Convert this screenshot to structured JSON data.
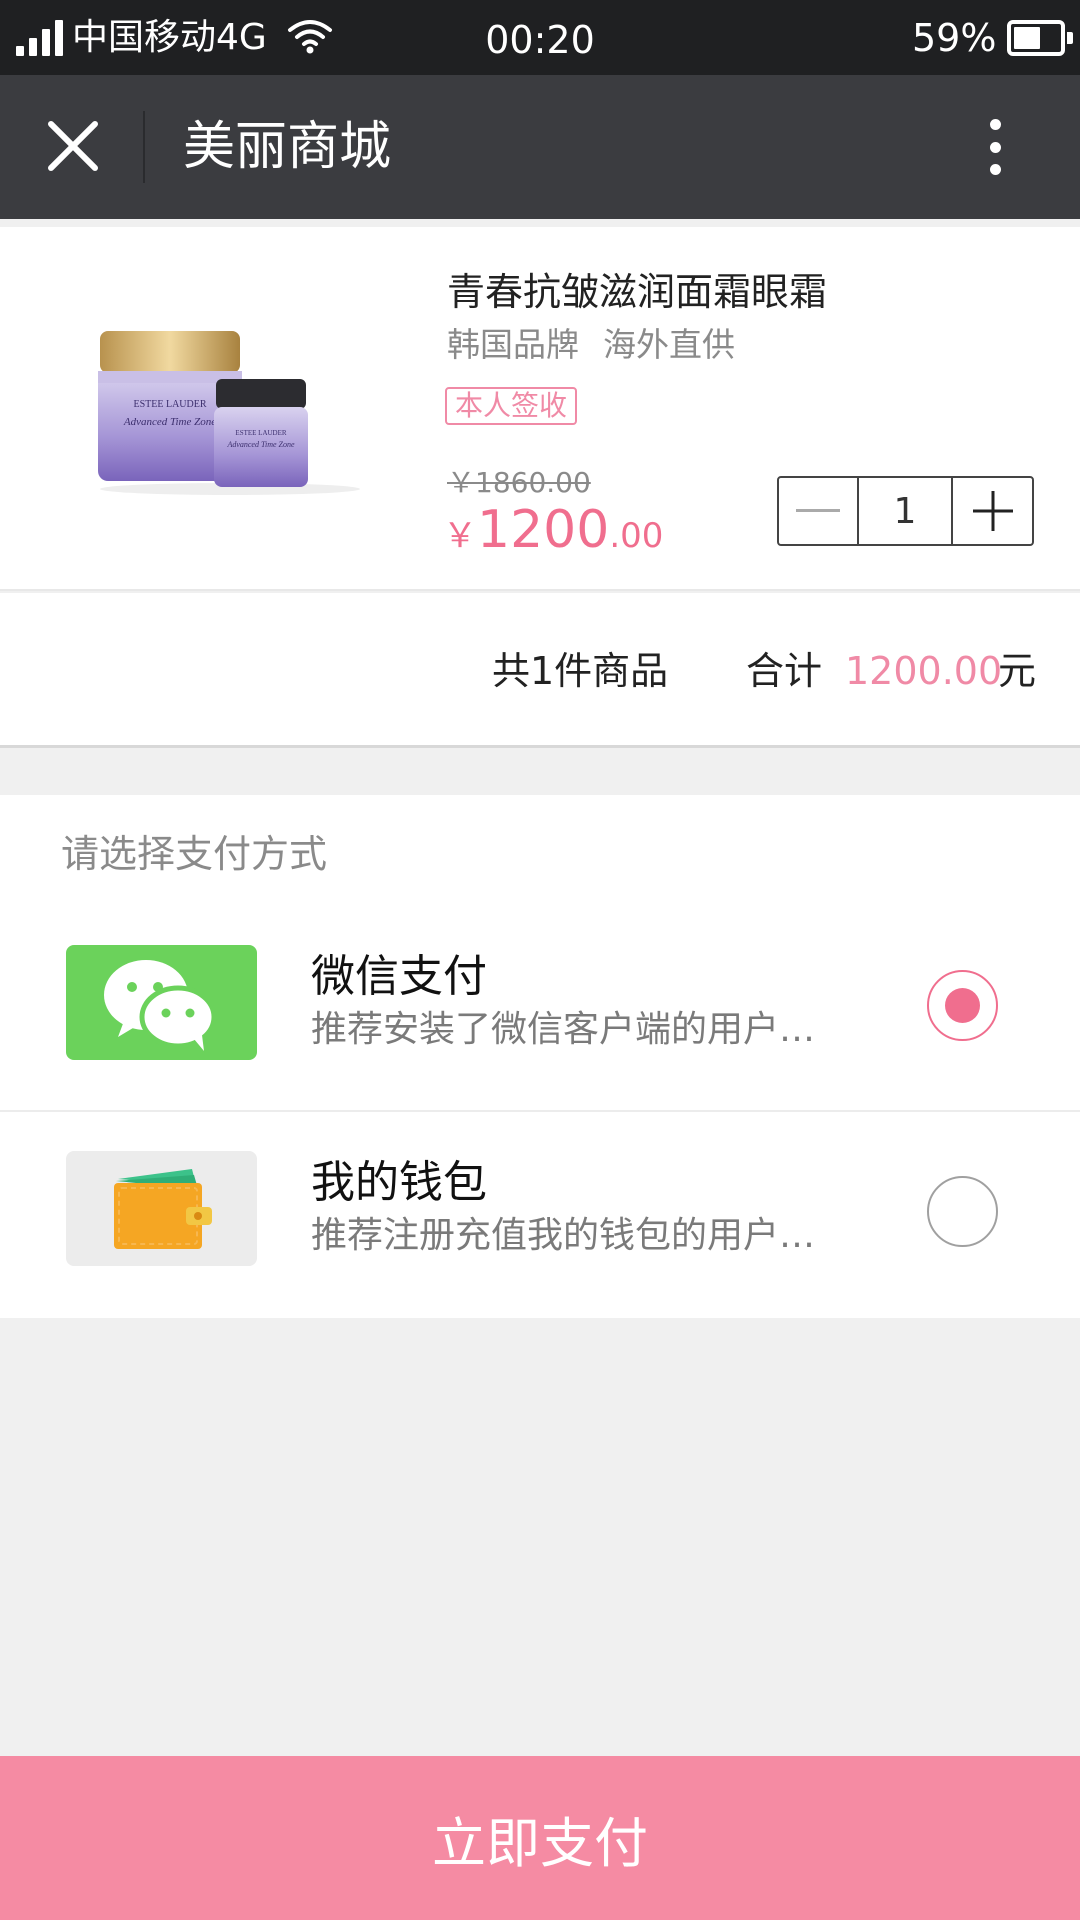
{
  "status_bar": {
    "carrier": "中国移动4G",
    "time": "00:20",
    "battery": "59%",
    "battery_level": 0.59,
    "icons": [
      "signal-icon",
      "wifi-icon",
      "battery-icon"
    ]
  },
  "title_bar": {
    "title": "美丽商城",
    "icons": [
      "close-icon",
      "more-vertical-icon"
    ]
  },
  "product": {
    "name": "青春抗皱滋润面霜眼霜",
    "tags": [
      "韩国品牌",
      "海外直供"
    ],
    "badge": "本人签收",
    "original_price": "￥1860.00",
    "currency": "￥",
    "price_integer": "1200",
    "price_decimal": ".00",
    "quantity": "1",
    "image_alt": "ESTEE LAUDER Advanced Time Zone"
  },
  "summary": {
    "count_text": "共1件商品",
    "total_label": "合计",
    "total_amount": "1200.00",
    "unit": "元"
  },
  "payment": {
    "header": "请选择支付方式",
    "options": [
      {
        "title": "微信支付",
        "desc": "推荐安装了微信客户端的用户…",
        "icon": "wechat-icon",
        "selected": true
      },
      {
        "title": "我的钱包",
        "desc": "推荐注册充值我的钱包的用户…",
        "icon": "wallet-icon",
        "selected": false
      }
    ]
  },
  "footer": {
    "pay_button": "立即支付"
  },
  "colors": {
    "accent": "#f06e8e",
    "button": "#f58ba3",
    "title_bar": "#3b3c40",
    "status_bar": "#1f2022",
    "wechat_green": "#6bd25b"
  }
}
